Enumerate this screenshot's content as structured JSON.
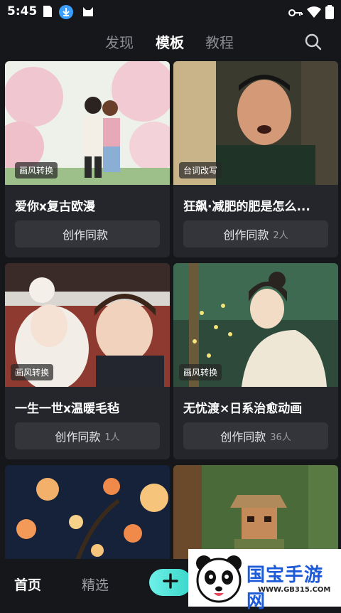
{
  "status": {
    "time": "5:45"
  },
  "top_nav": {
    "tabs": [
      "发现",
      "模板",
      "教程"
    ],
    "active_index": 1
  },
  "cards": [
    {
      "tag": "画风转换",
      "title": "爱你x复古欧漫",
      "button_label": "创作同款",
      "count": ""
    },
    {
      "tag": "台词改写",
      "title": "狂飙·减肥的肥是怎么...",
      "button_label": "创作同款",
      "count": "2人"
    },
    {
      "tag": "画风转换",
      "title": "一生一世x温暖毛毡",
      "button_label": "创作同款",
      "count": "1人"
    },
    {
      "tag": "画风转换",
      "title": "无忧渡×日系治愈动画",
      "button_label": "创作同款",
      "count": "36人"
    }
  ],
  "bottom_nav": {
    "home": "首页",
    "featured": "精选"
  },
  "watermark": {
    "text": "国宝手游网",
    "url": "WWW.GB315.COM"
  },
  "colors": {
    "background": "#16171b",
    "card": "#24262b",
    "button": "#33353a",
    "accent": "#38d6c9",
    "watermark_blue": "#1d5ad9"
  }
}
